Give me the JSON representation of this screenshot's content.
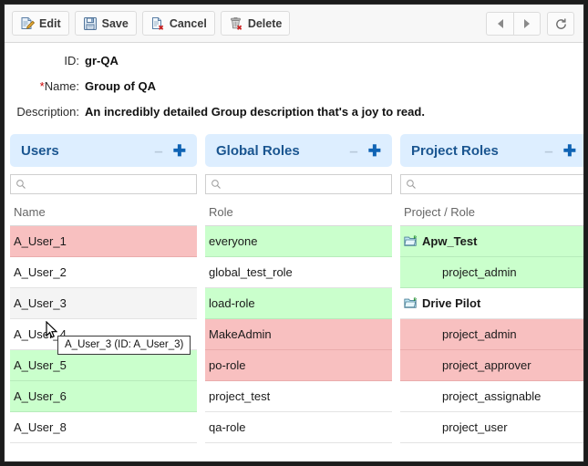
{
  "toolbar": {
    "buttons": [
      {
        "label": "Edit",
        "icon": "document-pencil-icon"
      },
      {
        "label": "Save",
        "icon": "floppy-disk-icon"
      },
      {
        "label": "Cancel",
        "icon": "document-delete-icon"
      },
      {
        "label": "Delete",
        "icon": "trash-delete-icon"
      }
    ],
    "nav": {
      "prev": "prev-arrow-icon",
      "next": "next-arrow-icon",
      "reload": "refresh-icon"
    }
  },
  "form": {
    "id_label": "ID:",
    "id_value": "gr-QA",
    "name_required_marker": "*",
    "name_label": "Name:",
    "name_value": "Group of QA",
    "description_label": "Description:",
    "description_value": "An incredibly detailed Group description that's a joy to read."
  },
  "panels": [
    {
      "title": "Users",
      "collapse_icon": "minus-icon",
      "add_icon": "plus-icon",
      "search_placeholder": "",
      "search_value": "",
      "column_header": "Name",
      "rows": [
        {
          "label": "A_User_1",
          "state": "red"
        },
        {
          "label": "A_User_2",
          "state": "none"
        },
        {
          "label": "A_User_3",
          "state": "hover"
        },
        {
          "label": "A_User_4",
          "state": "none"
        },
        {
          "label": "A_User_5",
          "state": "green"
        },
        {
          "label": "A_User_6",
          "state": "green"
        },
        {
          "label": "A_User_8",
          "state": "none"
        }
      ]
    },
    {
      "title": "Global Roles",
      "collapse_icon": "minus-icon",
      "add_icon": "plus-icon",
      "search_placeholder": "",
      "search_value": "",
      "column_header": "Role",
      "rows": [
        {
          "label": "everyone",
          "state": "green"
        },
        {
          "label": "global_test_role",
          "state": "none"
        },
        {
          "label": "load-role",
          "state": "green"
        },
        {
          "label": "MakeAdmin",
          "state": "red"
        },
        {
          "label": "po-role",
          "state": "red"
        },
        {
          "label": "project_test",
          "state": "none"
        },
        {
          "label": "qa-role",
          "state": "none"
        }
      ]
    },
    {
      "title": "Project Roles",
      "collapse_icon": "minus-icon",
      "add_icon": "plus-icon",
      "search_placeholder": "",
      "search_value": "",
      "column_header": "Project / Role",
      "rows": [
        {
          "label": "Apw_Test",
          "state": "green",
          "kind": "group",
          "icon": "project-folder-icon"
        },
        {
          "label": "project_admin",
          "state": "green",
          "kind": "child"
        },
        {
          "label": "Drive Pilot",
          "state": "none",
          "kind": "group",
          "icon": "project-folder-icon"
        },
        {
          "label": "project_admin",
          "state": "red",
          "kind": "child"
        },
        {
          "label": "project_approver",
          "state": "red",
          "kind": "child"
        },
        {
          "label": "project_assignable",
          "state": "none",
          "kind": "child"
        },
        {
          "label": "project_user",
          "state": "none",
          "kind": "child"
        }
      ]
    }
  ],
  "tooltip": {
    "text": "A_User_3 (ID: A_User_3)"
  },
  "colors": {
    "added_green": "#caffcc",
    "removed_red": "#f8c0c0",
    "panel_header_blue": "#ddeeff",
    "panel_title_blue": "#1a5590",
    "required_red": "#cc0000"
  }
}
